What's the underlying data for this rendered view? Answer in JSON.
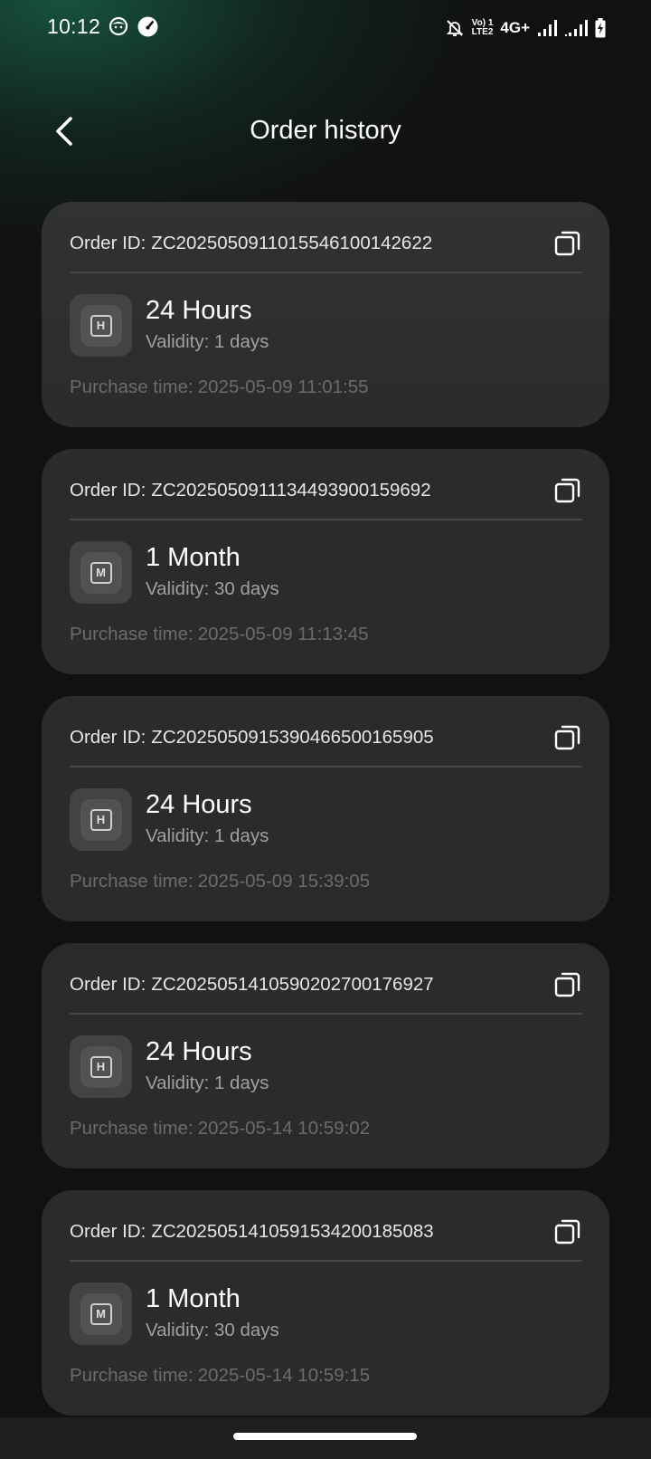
{
  "status_bar": {
    "time": "10:12",
    "left_icons": [
      "face-notification-icon",
      "speedometer-icon"
    ],
    "volte_top": "Vo) 1",
    "volte_bottom": "LTE2",
    "network": "4G+",
    "right_icons": [
      "mute-bell-icon",
      "signal-sim1-icon",
      "signal-sim2-icon",
      "battery-charging-icon"
    ]
  },
  "header": {
    "title": "Order history",
    "back_icon": "chevron-left-icon"
  },
  "labels": {
    "order_id_prefix": "Order ID:",
    "validity_prefix": "Validity:",
    "purchase_time_prefix": "Purchase time:"
  },
  "orders": [
    {
      "order_id": "ZC20250509110155461001426​22",
      "plan_icon_letter": "H",
      "plan_name": "24 Hours",
      "validity": "Validity: 1 days",
      "purchase_time": "2025-05-09 11:01:55"
    },
    {
      "order_id": "ZC2025050911134493900159692",
      "plan_icon_letter": "M",
      "plan_name": "1 Month",
      "validity": "Validity: 30 days",
      "purchase_time": "2025-05-09 11:13:45"
    },
    {
      "order_id": "ZC2025050915390466500165905",
      "plan_icon_letter": "H",
      "plan_name": "24 Hours",
      "validity": "Validity: 1 days",
      "purchase_time": "2025-05-09 15:39:05"
    },
    {
      "order_id": "ZC2025051410590202700176927",
      "plan_icon_letter": "H",
      "plan_name": "24 Hours",
      "validity": "Validity: 1 days",
      "purchase_time": "2025-05-14 10:59:02"
    },
    {
      "order_id": "ZC2025051410591534200185083",
      "plan_icon_letter": "M",
      "plan_name": "1 Month",
      "validity": "Validity: 30 days",
      "purchase_time": "2025-05-14 10:59:15"
    }
  ],
  "colors": {
    "background": "#111111",
    "accent_glow": "#185c48",
    "card": "#2b2b2b",
    "secondary_text": "#a0a0a0",
    "muted_text": "#6b6b6b"
  }
}
